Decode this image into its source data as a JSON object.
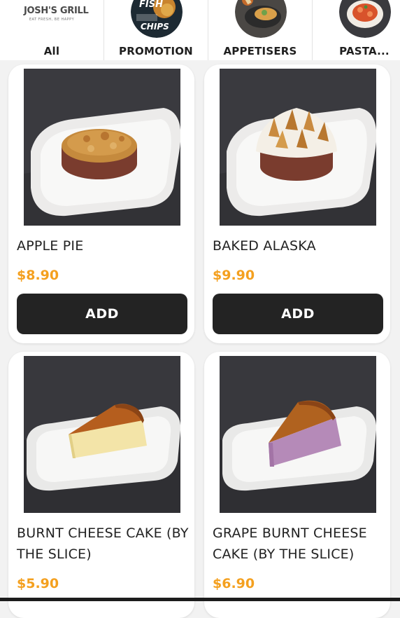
{
  "brand": {
    "name": "JOSH'S GRILL",
    "tagline": "EAT FRESH, BE HAPPY"
  },
  "categories": [
    {
      "label": "All",
      "icon": "josh-grill-logo"
    },
    {
      "label": "PROMOTION",
      "icon": "fish-and-chips-photo"
    },
    {
      "label": "APPETISERS",
      "icon": "appetiser-platter-photo"
    },
    {
      "label": "PASTA...",
      "icon": "pasta-bowl-photo"
    }
  ],
  "promo_badge": {
    "line1": "FISH",
    "line2": "CHIPS"
  },
  "products": [
    {
      "name": "APPLE PIE",
      "price": "$8.90",
      "add_label": "ADD",
      "photo": "apple-pie-photo"
    },
    {
      "name": "BAKED ALASKA",
      "price": "$9.90",
      "add_label": "ADD",
      "photo": "baked-alaska-photo"
    },
    {
      "name": "BURNT CHEESE CAKE (BY THE SLICE)",
      "price": "$5.90",
      "photo": "burnt-cheesecake-photo"
    },
    {
      "name": "GRAPE BURNT CHEESE CAKE (BY THE SLICE)",
      "price": "$6.90",
      "photo": "grape-cheesecake-photo"
    }
  ],
  "colors": {
    "price": "#f4a01f",
    "button": "#232323",
    "background": "#f2f2f2"
  }
}
